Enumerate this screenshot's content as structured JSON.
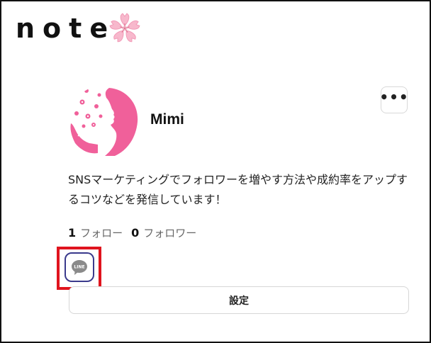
{
  "header": {
    "logo_text": "note",
    "logo_icon": "sakura-icon"
  },
  "profile": {
    "username": "Mimi",
    "avatar_icon": "woman-silhouette-flowers-avatar",
    "more_icon": "more-horizontal-icon",
    "more_label": "•••",
    "bio": "SNSマーケティングでフォロワーを増やす方法や成約率をアップするコツなどを発信しています！",
    "follow_count": "1",
    "follow_label": "フォロー",
    "follower_count": "0",
    "follower_label": "フォロワー"
  },
  "social": {
    "line_icon": "line-icon",
    "line_label": "LINE"
  },
  "actions": {
    "settings_label": "設定"
  },
  "colors": {
    "highlight": "#e0141e",
    "avatar_pink": "#f0609a",
    "line_border": "#3a3a8c",
    "line_gray": "#8a8a8a"
  }
}
